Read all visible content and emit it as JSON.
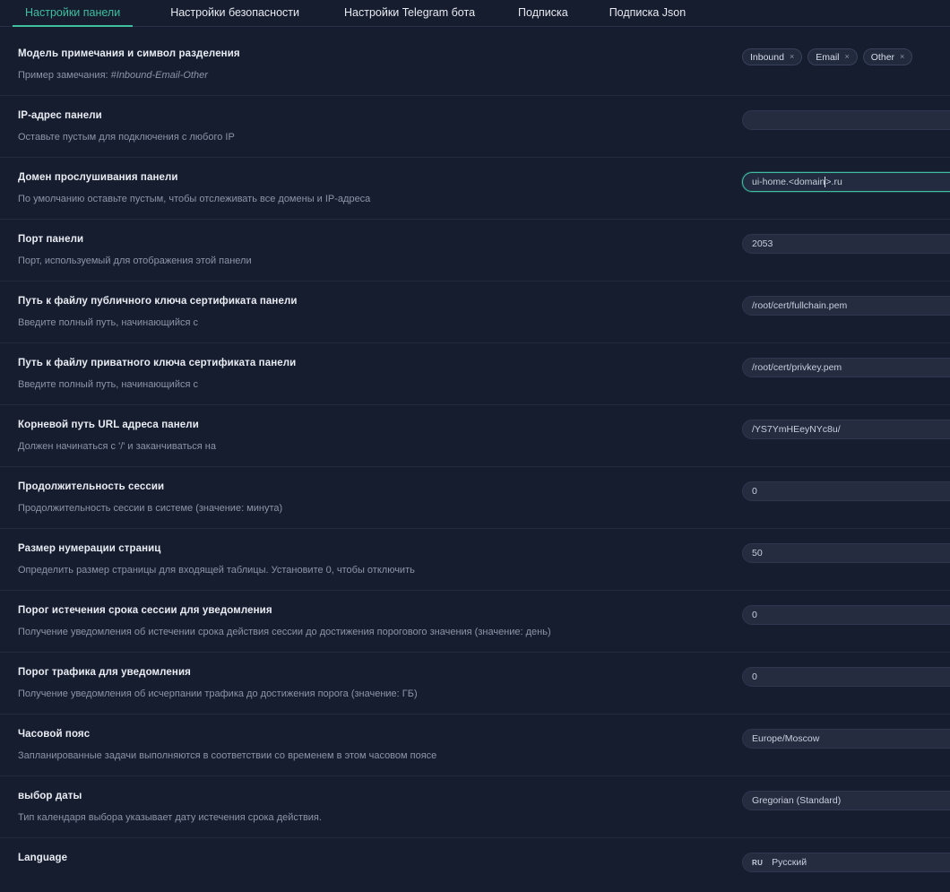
{
  "tabs": [
    {
      "label": "Настройки панели",
      "active": true
    },
    {
      "label": "Настройки безопасности",
      "active": false
    },
    {
      "label": "Настройки Telegram бота",
      "active": false
    },
    {
      "label": "Подписка",
      "active": false
    },
    {
      "label": "Подписка Json",
      "active": false
    }
  ],
  "colors": {
    "background": "#161d2f",
    "accent": "#3fbfa0",
    "divider": "#232b40",
    "field_bg": "#252c40",
    "text": "#e9ecf3",
    "muted": "#8d94a8"
  },
  "rows": [
    {
      "label": "Модель примечания и символ разделения",
      "desc_prefix": "Пример замечания: ",
      "desc_em": "#Inbound-Email-Other",
      "control": "tags",
      "tags": [
        "Inbound",
        "Email",
        "Other"
      ],
      "tag_close_icon": "×"
    },
    {
      "label": "IP-адрес панели",
      "desc": "Оставьте пустым для подключения с любого IP",
      "control": "input",
      "value": ""
    },
    {
      "label": "Домен прослушивания панели",
      "desc": "По умолчанию оставьте пустым, чтобы отслеживать все домены и IP-адреса",
      "control": "input-focused",
      "value_before_caret": "ui-home.<domain",
      "value_after_caret": ">.ru"
    },
    {
      "label": "Порт панели",
      "desc": "Порт, используемый для отображения этой панели",
      "control": "input",
      "value": "2053"
    },
    {
      "label": "Путь к файлу публичного ключа сертификата панели",
      "desc": "Введите полный путь, начинающийся с",
      "control": "input",
      "value": "/root/cert/fullchain.pem"
    },
    {
      "label": "Путь к файлу приватного ключа сертификата панели",
      "desc": "Введите полный путь, начинающийся с",
      "control": "input",
      "value": "/root/cert/privkey.pem"
    },
    {
      "label": "Корневой путь URL адреса панели",
      "desc": "Должен начинаться с '/' и заканчиваться на",
      "control": "input",
      "value": "/YS7YmHEeyNYc8u/"
    },
    {
      "label": "Продолжительность сессии",
      "desc": "Продолжительность сессии в системе (значение: минута)",
      "control": "input",
      "value": "0"
    },
    {
      "label": "Размер нумерации страниц",
      "desc": "Определить размер страницы для входящей таблицы. Установите 0, чтобы отключить",
      "control": "input",
      "value": "50"
    },
    {
      "label": "Порог истечения срока сессии для уведомления",
      "desc": "Получение уведомления об истечении срока действия сессии до достижения порогового значения (значение: день)",
      "control": "input",
      "value": "0"
    },
    {
      "label": "Порог трафика для уведомления",
      "desc": "Получение уведомления об исчерпании трафика до достижения порога (значение: ГБ)",
      "control": "input",
      "value": "0"
    },
    {
      "label": "Часовой пояс",
      "desc": "Запланированные задачи выполняются в соответствии со временем в этом часовом поясе",
      "control": "input",
      "value": "Europe/Moscow"
    },
    {
      "label": "выбор даты",
      "desc": "Тип календаря выбора указывает дату истечения срока действия.",
      "control": "input",
      "value": "Gregorian (Standard)"
    },
    {
      "label": "Language",
      "desc": "",
      "control": "language",
      "flag": "ru",
      "value": "Русский"
    }
  ]
}
